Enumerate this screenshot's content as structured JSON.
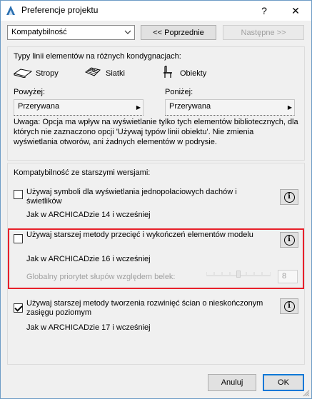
{
  "window": {
    "title": "Preferencje projektu",
    "help": "?",
    "close": "✕"
  },
  "toolbar": {
    "section_value": "Kompatybilność",
    "prev_label": "<< Poprzednie",
    "next_label": "Następne >>"
  },
  "line_types": {
    "heading": "Typy linii elementów na różnych kondygnacjach:",
    "items": [
      {
        "label": "Stropy",
        "icon": "slab-icon"
      },
      {
        "label": "Siatki",
        "icon": "mesh-icon"
      },
      {
        "label": "Obiekty",
        "icon": "object-icon"
      }
    ],
    "above_label": "Powyżej:",
    "above_value": "Przerywana",
    "below_label": "Poniżej:",
    "below_value": "Przerywana",
    "note": "Uwaga: Opcja ma wpływ na wyświetlanie tylko tych elementów bibliotecznych, dla których nie zaznaczono opcji 'Używaj typów linii obiektu'. Nie zmienia wyświetlania otworów, ani żadnych elementów w podrysie."
  },
  "compat": {
    "heading": "Kompatybilność ze starszymi wersjami:",
    "option1": {
      "label": "Używaj symboli dla wyświetlania jednopołaciowych dachów i świetlików",
      "sub": "Jak w ARCHICADzie 14 i wcześniej",
      "checked": false
    },
    "option2": {
      "label": "Używaj starszej metody przecięć i wykończeń elementów modelu",
      "sub": "Jak w ARCHICADzie 16 i wcześniej",
      "checked": false
    },
    "priority_label": "Globalny priorytet słupów względem belek:",
    "priority_value": "8",
    "priority_level": 0.5,
    "option3": {
      "label": "Używaj starszej metody tworzenia rozwinięć ścian o nieskończonym zasięgu poziomym",
      "sub": "Jak w ARCHICADzie 17 i wcześniej",
      "checked": true
    }
  },
  "footer": {
    "cancel_label": "Anuluj",
    "ok_label": "OK"
  },
  "colors": {
    "highlight": "#e8202a",
    "accent": "#0078d7"
  }
}
